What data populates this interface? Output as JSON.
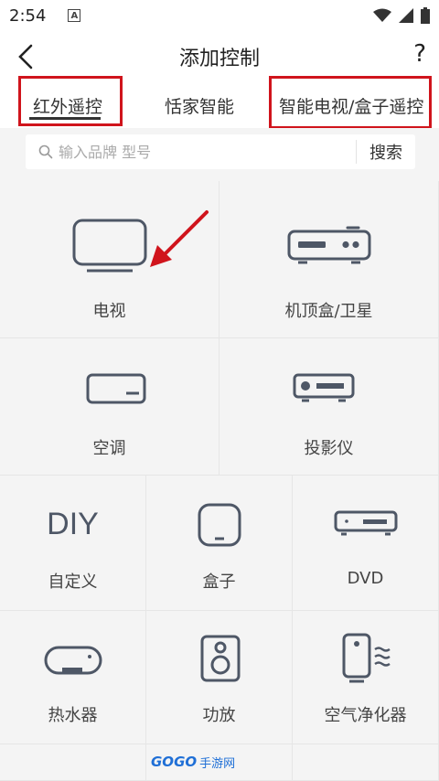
{
  "status_bar": {
    "time": "2:54",
    "notif_letter": "A"
  },
  "header": {
    "title": "添加控制",
    "help": "?"
  },
  "tabs": [
    {
      "label": "红外遥控"
    },
    {
      "label": "恬家智能"
    },
    {
      "label": "智能电视/盒子遥控"
    }
  ],
  "search": {
    "placeholder": "输入品牌 型号",
    "button": "搜索"
  },
  "devices": [
    {
      "label": "电视",
      "icon": "tv-icon"
    },
    {
      "label": "机顶盒/卫星",
      "icon": "set-top-box-icon"
    },
    {
      "label": "空调",
      "icon": "air-conditioner-icon"
    },
    {
      "label": "投影仪",
      "icon": "projector-icon"
    },
    {
      "label": "自定义",
      "icon": "diy-icon",
      "icon_text": "DIY"
    },
    {
      "label": "盒子",
      "icon": "box-icon"
    },
    {
      "label": "DVD",
      "icon": "dvd-icon"
    },
    {
      "label": "热水器",
      "icon": "water-heater-icon"
    },
    {
      "label": "功放",
      "icon": "amplifier-icon"
    },
    {
      "label": "空气净化器",
      "icon": "air-purifier-icon"
    }
  ],
  "watermark": {
    "brand": "GOGO",
    "suffix": "手游网"
  },
  "colors": {
    "highlight": "#d0141c",
    "icon_stroke": "#4e5766",
    "background": "#f4f4f4"
  }
}
